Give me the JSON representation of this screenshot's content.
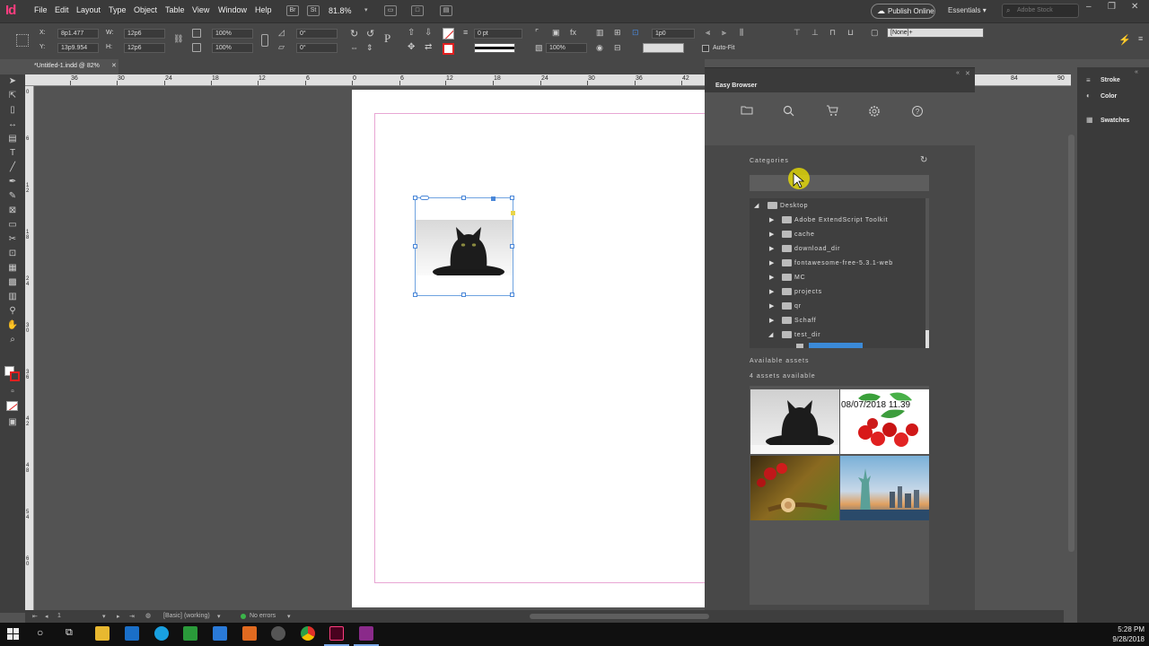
{
  "app": {
    "icon_text": "Id",
    "zoom": "81.8%"
  },
  "menu": [
    "File",
    "Edit",
    "Layout",
    "Type",
    "Object",
    "Table",
    "View",
    "Window",
    "Help"
  ],
  "topbar": {
    "publish": "Publish Online",
    "workspace": "Essentials",
    "search_placeholder": "Adobe Stock",
    "br": "Br",
    "st": "St"
  },
  "control": {
    "x_label": "X:",
    "x_value": "8p1.477",
    "y_label": "Y:",
    "y_value": "13p9.954",
    "w_label": "W:",
    "w_value": "12p6",
    "h_label": "H:",
    "h_value": "12p6",
    "scale_x": "100%",
    "scale_y": "100%",
    "rot": "0°",
    "shear": "0°",
    "stroke_weight": "0 pt",
    "pct": "100%",
    "offset": "1p0",
    "style": "[None]+",
    "autofit": "Auto-Fit"
  },
  "document": {
    "tab": "*Untitled-1.indd @ 82%"
  },
  "ruler_top": [
    "36",
    "30",
    "24",
    "18",
    "12",
    "6",
    "0",
    "6",
    "12",
    "18",
    "24",
    "30",
    "36",
    "42"
  ],
  "ruler_top2": [
    "84",
    "90"
  ],
  "ruler_left": [
    "0",
    "6",
    "1\n2",
    "1\n8",
    "2\n4",
    "3\n0",
    "3\n6",
    "4\n2",
    "4\n8",
    "5\n4",
    "6\n0"
  ],
  "status": {
    "page": "1",
    "preflight_profile": "[Basic] (working)",
    "errors": "No errors"
  },
  "panel": {
    "title": "Easy Browser",
    "categories_label": "Categories",
    "tree": [
      {
        "label": "Desktop",
        "level": 0,
        "open": true
      },
      {
        "label": "Adobe ExtendScript Toolkit",
        "level": 1,
        "open": false
      },
      {
        "label": "cache",
        "level": 1,
        "open": false
      },
      {
        "label": "download_dir",
        "level": 1,
        "open": false
      },
      {
        "label": "fontawesome-free-5.3.1-web",
        "level": 1,
        "open": false
      },
      {
        "label": "MC",
        "level": 1,
        "open": false
      },
      {
        "label": "projects",
        "level": 1,
        "open": false
      },
      {
        "label": "qr",
        "level": 1,
        "open": false
      },
      {
        "label": "Schaff",
        "level": 1,
        "open": false
      },
      {
        "label": "test_dir",
        "level": 1,
        "open": true
      }
    ],
    "available_label": "Available assets",
    "assets_count": "4 assets available",
    "asset_overlay_text": "08/07/2018 11.39",
    "assets": [
      "cat-photo",
      "berries-photo",
      "snail-photo",
      "statue-of-liberty-photo"
    ]
  },
  "right_dock": [
    "Stroke",
    "Color",
    "Swatches"
  ],
  "taskbar": {
    "time": "5:28 PM",
    "date": "9/28/2018"
  },
  "colors": {
    "accent": "#4a87d8",
    "margin": "#e8a6d4",
    "app_pink": "#ff3d7f"
  }
}
